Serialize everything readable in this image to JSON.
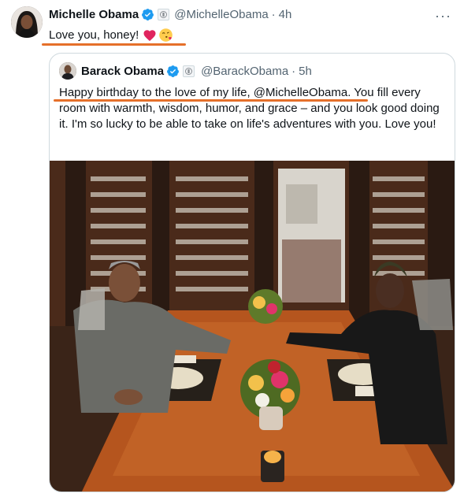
{
  "tweet": {
    "author_name": "Michelle Obama",
    "handle": "@MichelleObama",
    "separator": "·",
    "time": "4h",
    "text": "Love you, honey!",
    "emojis": [
      "red-heart-icon",
      "face-blowing-kiss-icon"
    ],
    "more_label": "···"
  },
  "quote": {
    "author_name": "Barack Obama",
    "handle": "@BarackObama",
    "separator": "·",
    "time": "5h",
    "text": "Happy birthday to the love of my life, @MichelleObama. You fill every room with warmth, wisdom, humor, and grace – and you look good doing it. I'm so lucky to be able to take on life's adventures with you. Love you!"
  },
  "colors": {
    "verified": "#1d9bf0",
    "annotation_underline": "#e5702a",
    "text": "#0f1419",
    "muted": "#536471",
    "border": "#cfd9de"
  }
}
